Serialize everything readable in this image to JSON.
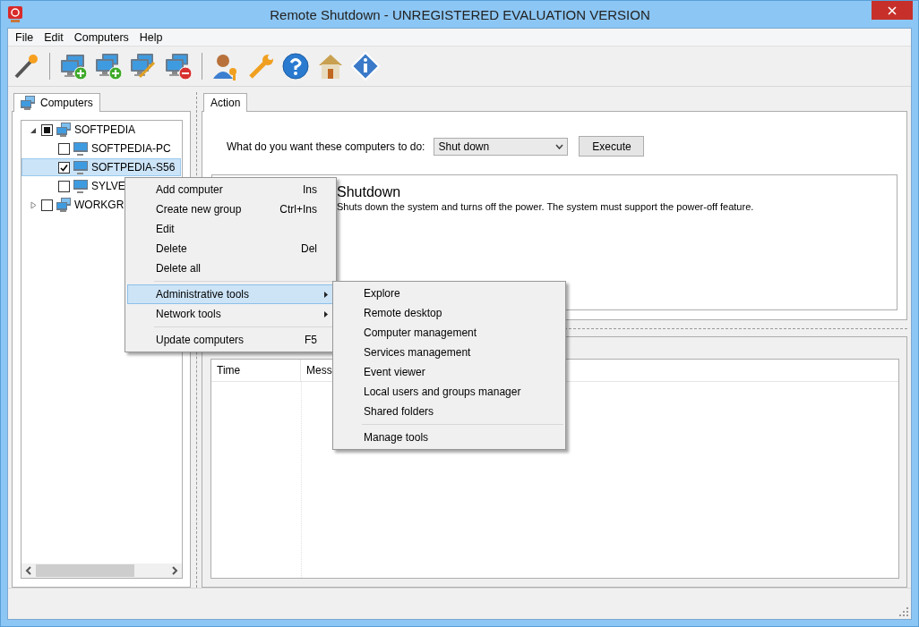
{
  "window": {
    "title": "Remote Shutdown - UNREGISTERED EVALUATION VERSION"
  },
  "menu_bar": [
    "File",
    "Edit",
    "Computers",
    "Help"
  ],
  "left_panel": {
    "tab": {
      "label": "Computers",
      "selected": true
    },
    "tree": [
      {
        "kind": "group",
        "label": "SOFTPEDIA",
        "expanded": true,
        "checked": false,
        "mixed": true,
        "selected": false,
        "children": [
          {
            "kind": "computer",
            "label": "SOFTPEDIA-PC",
            "checked": false,
            "selected": false
          },
          {
            "kind": "computer",
            "label": "SOFTPEDIA-S56",
            "checked": true,
            "selected": true
          },
          {
            "kind": "computer",
            "label": "SYLVE",
            "checked": false,
            "selected": false
          }
        ]
      },
      {
        "kind": "group",
        "label": "WORKGR",
        "expanded": false,
        "checked": false,
        "selected": false
      }
    ]
  },
  "action_panel": {
    "tab": {
      "label": "Action",
      "selected": true
    },
    "prompt": "What do you want these computers to do:",
    "action_select": {
      "value": "Shut down"
    },
    "execute_button": "Execute",
    "description": {
      "title": "Shutdown",
      "text": "Shuts down the system and turns off the power. The system must support the power-off feature."
    }
  },
  "log_table": {
    "columns": [
      "Time",
      "Mess"
    ]
  },
  "context_menu": [
    {
      "kind": "item",
      "label": "Add computer",
      "shortcut": "Ins",
      "submenu": false,
      "selected": false
    },
    {
      "kind": "item",
      "label": "Create new group",
      "shortcut": "Ctrl+Ins",
      "submenu": false,
      "selected": false
    },
    {
      "kind": "item",
      "label": "Edit",
      "submenu": false,
      "selected": false
    },
    {
      "kind": "item",
      "label": "Delete",
      "shortcut": "Del",
      "submenu": false,
      "selected": false
    },
    {
      "kind": "item",
      "label": "Delete all",
      "submenu": false,
      "selected": false
    },
    {
      "kind": "separator"
    },
    {
      "kind": "item",
      "label": "Administrative tools",
      "submenu": true,
      "selected": true
    },
    {
      "kind": "item",
      "label": "Network tools",
      "submenu": true,
      "selected": false
    },
    {
      "kind": "separator"
    },
    {
      "kind": "item",
      "label": "Update computers",
      "shortcut": "F5",
      "submenu": false,
      "selected": false
    }
  ],
  "submenu": [
    {
      "kind": "item",
      "label": "Explore",
      "selected": false
    },
    {
      "kind": "item",
      "label": "Remote desktop",
      "selected": false
    },
    {
      "kind": "item",
      "label": "Computer management",
      "selected": false
    },
    {
      "kind": "item",
      "label": "Services management",
      "selected": false
    },
    {
      "kind": "item",
      "label": "Event viewer",
      "selected": false
    },
    {
      "kind": "item",
      "label": "Local users and groups manager",
      "selected": false
    },
    {
      "kind": "item",
      "label": "Shared folders",
      "selected": false
    },
    {
      "kind": "separator"
    },
    {
      "kind": "item",
      "label": "Manage tools",
      "selected": false
    }
  ]
}
